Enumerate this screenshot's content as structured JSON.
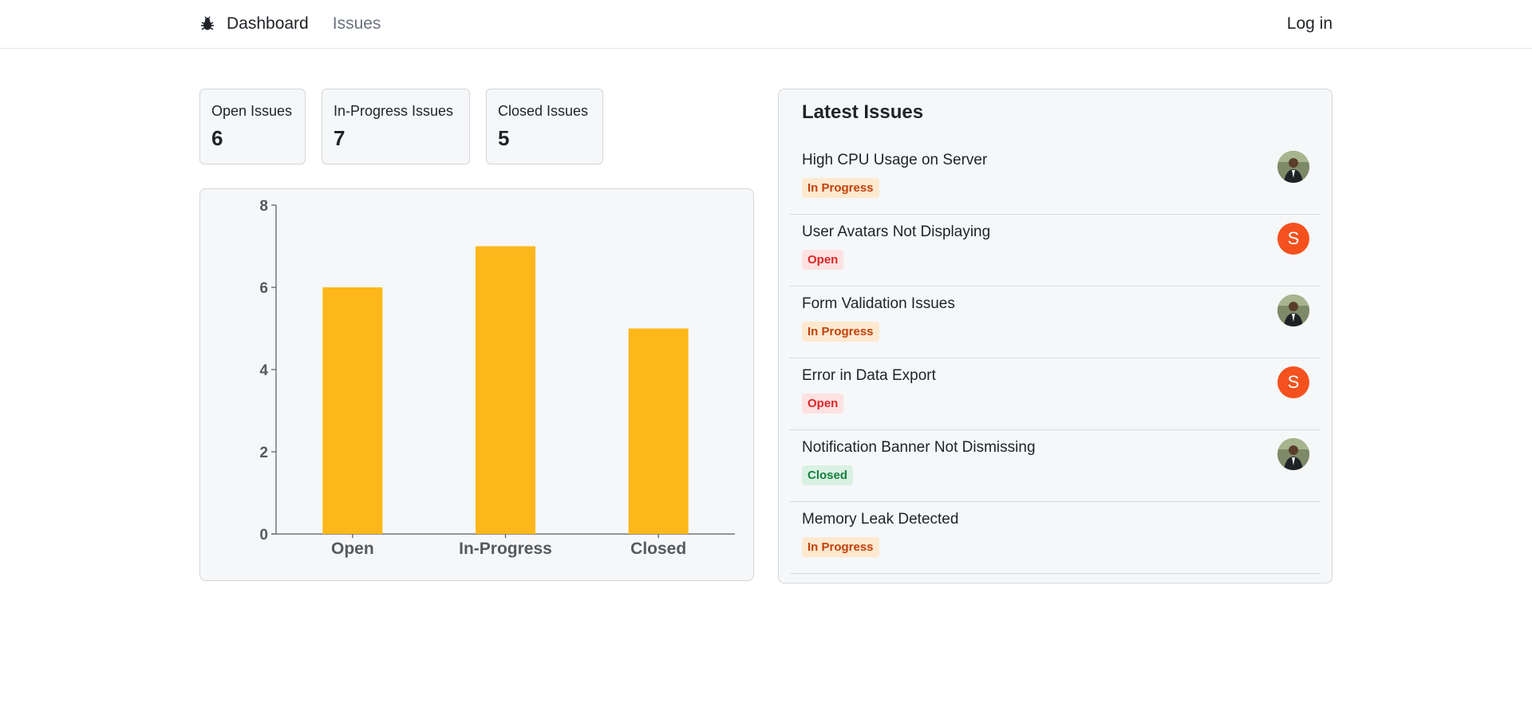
{
  "nav": {
    "logo_icon": "bug-icon",
    "dashboard_label": "Dashboard",
    "issues_label": "Issues",
    "login_label": "Log in"
  },
  "stats": [
    {
      "label": "Open Issues",
      "value": "6"
    },
    {
      "label": "In-Progress Issues",
      "value": "7"
    },
    {
      "label": "Closed Issues",
      "value": "5"
    }
  ],
  "chart_data": {
    "type": "bar",
    "categories": [
      "Open",
      "In-Progress",
      "Closed"
    ],
    "values": [
      6,
      7,
      5
    ],
    "ylim": [
      0,
      8
    ],
    "yticks": [
      "0",
      "2",
      "4",
      "6",
      "8"
    ],
    "bar_color": "#fdb71a"
  },
  "latest": {
    "title": "Latest Issues",
    "issues": [
      {
        "title": "High CPU Usage on Server",
        "status": "In Progress",
        "status_key": "in-progress",
        "avatar": "photo"
      },
      {
        "title": "User Avatars Not Displaying",
        "status": "Open",
        "status_key": "open",
        "avatar": "letter",
        "avatar_letter": "S"
      },
      {
        "title": "Form Validation Issues",
        "status": "In Progress",
        "status_key": "in-progress",
        "avatar": "photo"
      },
      {
        "title": "Error in Data Export",
        "status": "Open",
        "status_key": "open",
        "avatar": "letter",
        "avatar_letter": "S"
      },
      {
        "title": "Notification Banner Not Dismissing",
        "status": "Closed",
        "status_key": "closed",
        "avatar": "photo"
      },
      {
        "title": "Memory Leak Detected",
        "status": "In Progress",
        "status_key": "in-progress",
        "avatar": "none"
      }
    ]
  },
  "colors": {
    "in_progress_bg": "#fde9cf",
    "open_bg": "#fde1e1",
    "closed_bg": "#d9f1e3",
    "avatar_letter_bg": "#f4511e"
  }
}
